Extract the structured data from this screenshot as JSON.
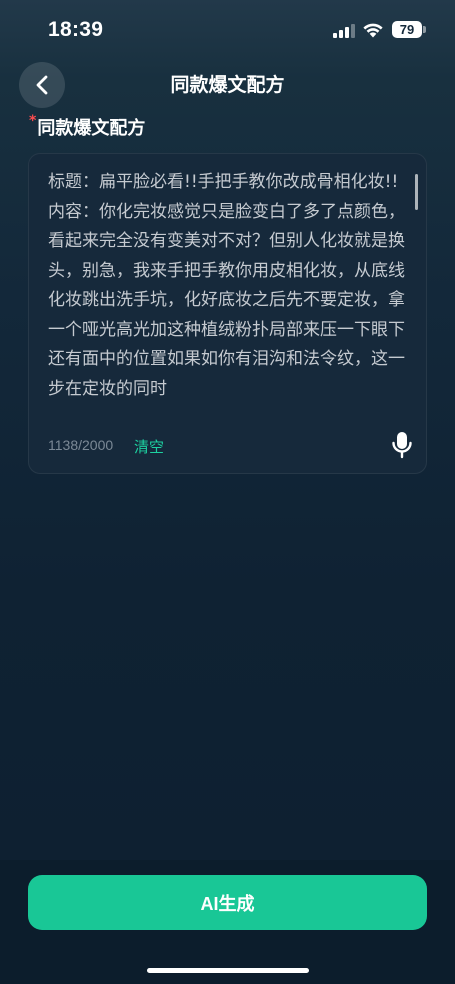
{
  "status_bar": {
    "time": "18:39",
    "battery": "79"
  },
  "nav": {
    "title": "同款爆文配方"
  },
  "section": {
    "required_mark": "*",
    "label": "同款爆文配方"
  },
  "editor": {
    "content": "标题：扁平脸必看!!手把手教你改成骨相化妆!!\n内容：你化完妆感觉只是脸变白了多了点颜色，看起来完全没有变美对不对？但别人化妆就是换头，别急，我来手把手教你用皮相化妆，从底线化妆跳出洗手坑，化好底妆之后先不要定妆，拿一个哑光高光加这种植绒粉扑局部来压一下眼下还有面中的位置如果如你有泪沟和法令纹，这一步在定妆的同时",
    "char_count": "1138/2000",
    "clear_label": "清空"
  },
  "action": {
    "generate_label": "AI生成"
  },
  "colors": {
    "accent": "#19c796",
    "clear_text": "#1dd1a0",
    "required": "#ff4d4f"
  },
  "icons": [
    "back-icon",
    "signal-icon",
    "wifi-icon",
    "battery-icon",
    "microphone-icon"
  ]
}
